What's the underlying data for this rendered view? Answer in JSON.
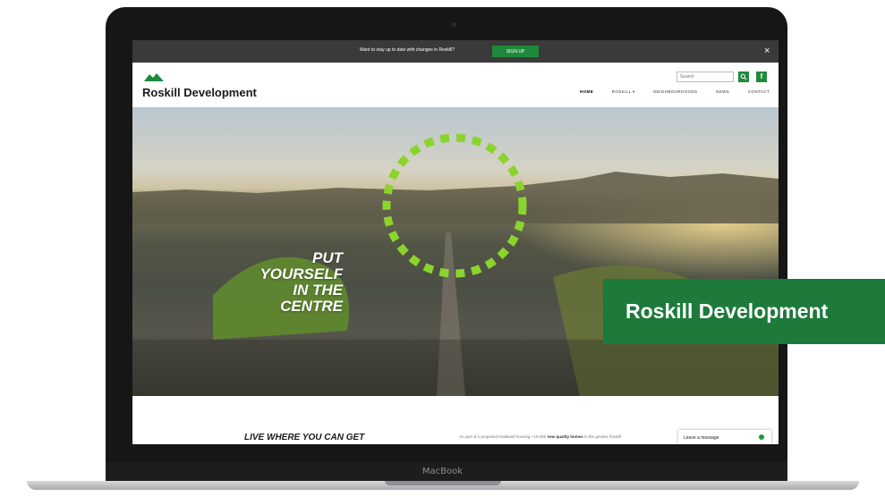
{
  "device": {
    "brand_label": "MacBook"
  },
  "notice_bar": {
    "text": "Want to stay up to date with changes in Roskill?",
    "button_label": "SIGN UP",
    "close_glyph": "×"
  },
  "header": {
    "logo_text": "Roskill Development",
    "logo_icon": "hills-logo-icon",
    "search": {
      "placeholder": "Search",
      "icon": "search-icon"
    },
    "social": {
      "label": "f",
      "icon": "facebook-icon"
    },
    "nav": [
      {
        "label": "HOME",
        "active": true
      },
      {
        "label": "ROSKILL ▾",
        "active": false
      },
      {
        "label": "NEIGHBOURHOODS",
        "active": false
      },
      {
        "label": "NEWS",
        "active": false
      },
      {
        "label": "CONTACT",
        "active": false
      }
    ]
  },
  "hero": {
    "headline_lines": [
      "PUT",
      "YOURSELF",
      "IN THE",
      "CENTRE"
    ],
    "accent_color": "#8bd42e"
  },
  "content": {
    "heading": "LIVE WHERE YOU CAN GET",
    "intro_before": "As part of a proposed KiwiBuild housing ~10,000 ",
    "intro_bold": "new quality homes",
    "intro_after": " in the greater Roskill",
    "chat_label": "Leave a message"
  },
  "overlay_label": {
    "text": "Roskill Development"
  },
  "colors": {
    "brand_green": "#1f8a3c",
    "overlay_green": "#1d7a3a",
    "notice_bg": "#3a3a3a"
  }
}
